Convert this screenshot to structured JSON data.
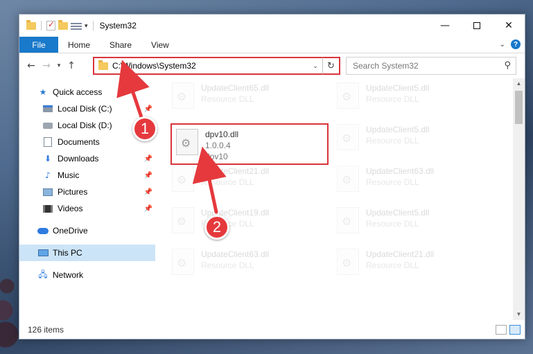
{
  "window": {
    "title": "System32"
  },
  "ribbon": {
    "file": "File",
    "home": "Home",
    "share": "Share",
    "view": "View"
  },
  "address": {
    "path": "C:\\Windows\\System32"
  },
  "search": {
    "placeholder": "Search System32"
  },
  "sidebar": {
    "items": [
      {
        "label": "Quick access",
        "icon": "star-icon"
      },
      {
        "label": "Local Disk (C:)",
        "icon": "drive-icon"
      },
      {
        "label": "Local Disk (D:)",
        "icon": "drive-icon"
      },
      {
        "label": "Documents",
        "icon": "document-icon"
      },
      {
        "label": "Downloads",
        "icon": "download-icon"
      },
      {
        "label": "Music",
        "icon": "music-icon"
      },
      {
        "label": "Pictures",
        "icon": "pictures-icon"
      },
      {
        "label": "Videos",
        "icon": "videos-icon"
      },
      {
        "label": "OneDrive",
        "icon": "cloud-icon"
      },
      {
        "label": "This PC",
        "icon": "computer-icon"
      },
      {
        "label": "Network",
        "icon": "network-icon"
      }
    ]
  },
  "files": {
    "highlighted": {
      "name": "dpv10.dll",
      "version": "1.0.0.4",
      "description": "dpv10"
    },
    "faded": [
      {
        "name": "UpdateClient65.dll",
        "description": "Resource DLL"
      },
      {
        "name": "UpdateClient5.dll",
        "description": "Resource DLL"
      },
      {
        "name": "UpdateClient5.dll",
        "description": "Resource DLL"
      },
      {
        "name": "UpdateClient21.dll",
        "description": "Resource DLL"
      },
      {
        "name": "UpdateClient63.dll",
        "description": "Resource DLL"
      },
      {
        "name": "UpdateClient19.dll",
        "description": "Resource DLL"
      },
      {
        "name": "UpdateClient5.dll",
        "description": "Resource DLL"
      },
      {
        "name": "UpdateClient63.dll",
        "description": "Resource DLL"
      },
      {
        "name": "UpdateClient21.dll",
        "description": "Resource DLL"
      }
    ]
  },
  "status": {
    "count": "126 items"
  },
  "annotations": {
    "step1": "1",
    "step2": "2"
  },
  "colors": {
    "accent": "#1979ca",
    "highlight_border": "#d9343a",
    "badge": "#e5393d"
  }
}
